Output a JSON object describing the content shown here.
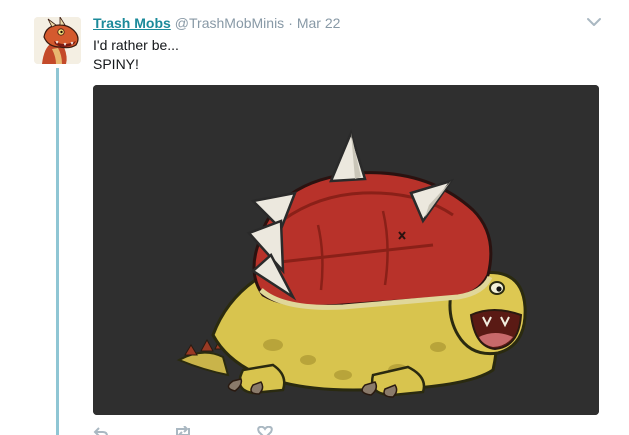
{
  "tweet": {
    "author_name": "Trash Mobs",
    "author_handle": "@TrashMobMinis",
    "separator": "·",
    "date": "Mar 22",
    "text_lines": [
      "I'd rather be...",
      "SPINY!"
    ],
    "media_alt": "spiny-shell-turtle-illustration",
    "avatar_icon": "red-dragon-avatar"
  },
  "icons": {
    "menu": "chevron-down-icon",
    "reply": "reply-icon",
    "retweet": "retweet-icon",
    "like": "heart-icon"
  },
  "colors": {
    "link": "#1b8a9a",
    "muted": "#8899a6",
    "thread_line": "#8fc6d4",
    "media_bg": "#2f2f2f"
  }
}
